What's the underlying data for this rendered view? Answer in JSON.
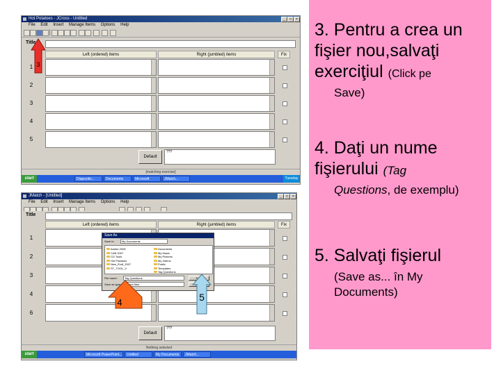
{
  "screens": {
    "top": {
      "window_title": "Hot Potatoes - JCross - Untitled",
      "menu": [
        "File",
        "Edit",
        "Insert",
        "Manage Items",
        "Options",
        "Help"
      ],
      "title_label": "Title",
      "col_left": "Left (ordered) items",
      "col_right": "Right (jumbled) items",
      "col_fix": "Fix",
      "rows": [
        "1",
        "2",
        "3",
        "4",
        "5"
      ],
      "default_button": "Default",
      "default_text": "???",
      "status": "[matching exercise]",
      "tasks": [
        "start",
        "Diapozitiv...",
        "Documents",
        "Microsoft",
        "JMatch...",
        "Tuesday"
      ]
    },
    "bottom": {
      "window_title": "JMatch - [Untitled]",
      "menu": [
        "File",
        "Edit",
        "Insert",
        "Manage Items",
        "Options",
        "Help"
      ],
      "title_label": "Title",
      "col_left": "Left (ordered) items",
      "col_right": "Right (jumbled) items",
      "col_fix": "Fix",
      "rows": [
        "1",
        "2",
        "3",
        "4",
        "6"
      ],
      "default_button": "Default",
      "default_text": "???",
      "status": "Nothing selected",
      "tasks": [
        "start",
        "Microsoft PowerPoint...",
        "Untitled",
        "My Documents",
        "JMatch..."
      ],
      "dialog": {
        "title": "Save As",
        "save_in_label": "Save in:",
        "save_in_value": "My Documents",
        "left_items": [
          "Adobe 2005",
          "CAB 2007",
          "CD Tools",
          "Hot Potatoes",
          "New_Ecdl_2007",
          "ST_TOOL_V"
        ],
        "right_items": [
          "Documents",
          "My Music",
          "My Pictures",
          "My Videos",
          "Public",
          "Templates",
          "Tag Questions"
        ],
        "filename_label": "File name:",
        "filename_value": "Tag Questions",
        "type_label": "Save as type:",
        "type_value": "JMatch files",
        "save_button": "Save",
        "cancel_button": "Cancel"
      }
    }
  },
  "callouts": {
    "arrow_top": "3",
    "arrow_left": "4",
    "arrow_right": "5"
  },
  "instructions": {
    "step3_main": "3. Pentru a crea un fişier nou,salvaţi exerciţiul",
    "step3_detail_a": "(Click pe",
    "step3_detail_b": "Save)",
    "step4_main": "4. Daţi un nume fişierului",
    "step4_detail_a": "(Tag",
    "step4_detail_b": "Questions",
    "step4_detail_c": ", de exemplu)",
    "step5_main": "5. Salvaţi fişierul",
    "step5_detail": "(Save as... în My Documents)"
  },
  "colors": {
    "panel": "#ff99cc",
    "arrow_orange": "#ff6a1a",
    "arrow_blue": "#a8d8f0",
    "arrow_red": "#e8302a"
  }
}
